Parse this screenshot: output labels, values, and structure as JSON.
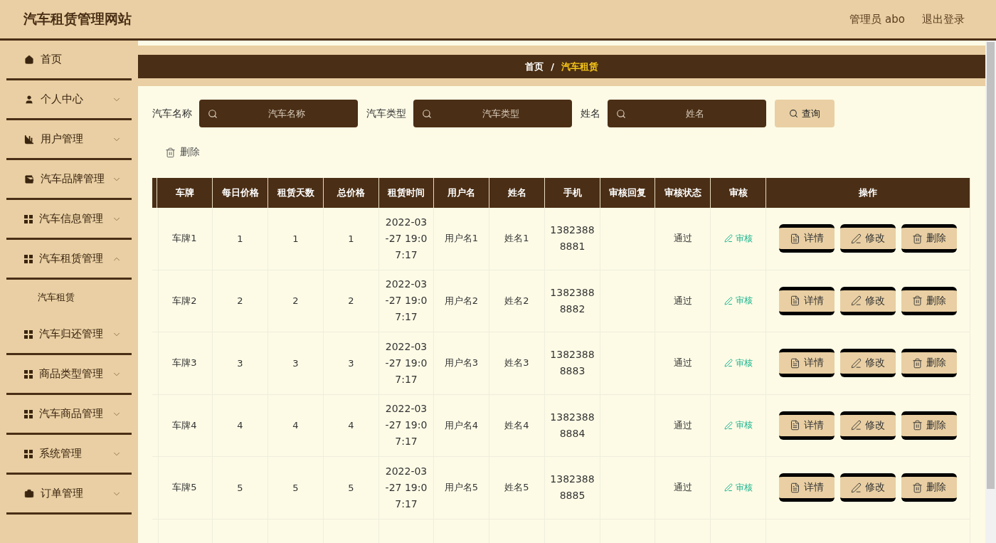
{
  "header": {
    "title": "汽车租赁管理网站",
    "user": "管理员 abo",
    "logout": "退出登录"
  },
  "sidebar": {
    "items": [
      {
        "label": "首页",
        "kind": "home",
        "expandable": false
      },
      {
        "label": "个人中心",
        "kind": "user",
        "expandable": true,
        "expanded": false
      },
      {
        "label": "用户管理",
        "kind": "chart",
        "expandable": true,
        "expanded": false
      },
      {
        "label": "汽车品牌管理",
        "kind": "wallet",
        "expandable": true,
        "expanded": false
      },
      {
        "label": "汽车信息管理",
        "kind": "grid",
        "expandable": true,
        "expanded": false
      },
      {
        "label": "汽车租赁管理",
        "kind": "grid",
        "expandable": true,
        "expanded": true,
        "children": [
          {
            "label": "汽车租赁"
          }
        ]
      },
      {
        "label": "汽车归还管理",
        "kind": "grid",
        "expandable": true,
        "expanded": false
      },
      {
        "label": "商品类型管理",
        "kind": "grid",
        "expandable": true,
        "expanded": false
      },
      {
        "label": "汽车商品管理",
        "kind": "grid",
        "expandable": true,
        "expanded": false
      },
      {
        "label": "系统管理",
        "kind": "grid",
        "expandable": true,
        "expanded": false
      },
      {
        "label": "订单管理",
        "kind": "briefcase",
        "expandable": true,
        "expanded": false
      }
    ]
  },
  "breadcrumb": [
    {
      "label": "首页",
      "selected": false
    },
    {
      "label": "汽车租赁",
      "selected": true
    }
  ],
  "breadcrumb_separator": "/",
  "search": {
    "fields": [
      {
        "label": "汽车名称",
        "placeholder": "汽车名称"
      },
      {
        "label": "汽车类型",
        "placeholder": "汽车类型"
      },
      {
        "label": "姓名",
        "placeholder": "姓名"
      }
    ],
    "button": "查询"
  },
  "bulk_delete": "删除",
  "table": {
    "columns": [
      "车牌",
      "每日价格",
      "租赁天数",
      "总价格",
      "租赁时间",
      "用户名",
      "姓名",
      "手机",
      "审核回复",
      "审核状态",
      "审核",
      "操作"
    ],
    "rows": [
      {
        "plate": "车牌1",
        "daily": "1",
        "days": "1",
        "total": "1",
        "time": "2022-03-27 19:07:17",
        "user": "用户名1",
        "name": "姓名1",
        "phone": "13823888881",
        "status": "通过",
        "audit": "审核",
        "actions": [
          {
            "kind": "detail",
            "label": "详情"
          },
          {
            "kind": "edit",
            "label": "修改"
          },
          {
            "kind": "delete",
            "label": "删除"
          }
        ]
      },
      {
        "plate": "车牌2",
        "daily": "2",
        "days": "2",
        "total": "2",
        "time": "2022-03-27 19:07:17",
        "user": "用户名2",
        "name": "姓名2",
        "phone": "13823888882",
        "status": "通过",
        "audit": "审核",
        "actions": [
          {
            "kind": "detail",
            "label": "详情"
          },
          {
            "kind": "edit",
            "label": "修改"
          },
          {
            "kind": "delete",
            "label": "删除"
          }
        ]
      },
      {
        "plate": "车牌3",
        "daily": "3",
        "days": "3",
        "total": "3",
        "time": "2022-03-27 19:07:17",
        "user": "用户名3",
        "name": "姓名3",
        "phone": "13823888883",
        "status": "通过",
        "audit": "审核",
        "actions": [
          {
            "kind": "detail",
            "label": "详情"
          },
          {
            "kind": "edit",
            "label": "修改"
          },
          {
            "kind": "delete",
            "label": "删除"
          }
        ]
      },
      {
        "plate": "车牌4",
        "daily": "4",
        "days": "4",
        "total": "4",
        "time": "2022-03-27 19:07:17",
        "user": "用户名4",
        "name": "姓名4",
        "phone": "13823888884",
        "status": "通过",
        "audit": "审核",
        "actions": [
          {
            "kind": "detail",
            "label": "详情"
          },
          {
            "kind": "edit",
            "label": "修改"
          },
          {
            "kind": "delete",
            "label": "删除"
          }
        ]
      },
      {
        "plate": "车牌5",
        "daily": "5",
        "days": "5",
        "total": "5",
        "time": "2022-03-27 19:07:17",
        "user": "用户名5",
        "name": "姓名5",
        "phone": "13823888885",
        "status": "通过",
        "audit": "审核",
        "actions": [
          {
            "kind": "detail",
            "label": "详情"
          },
          {
            "kind": "edit",
            "label": "修改"
          },
          {
            "kind": "delete",
            "label": "删除"
          }
        ]
      }
    ]
  }
}
